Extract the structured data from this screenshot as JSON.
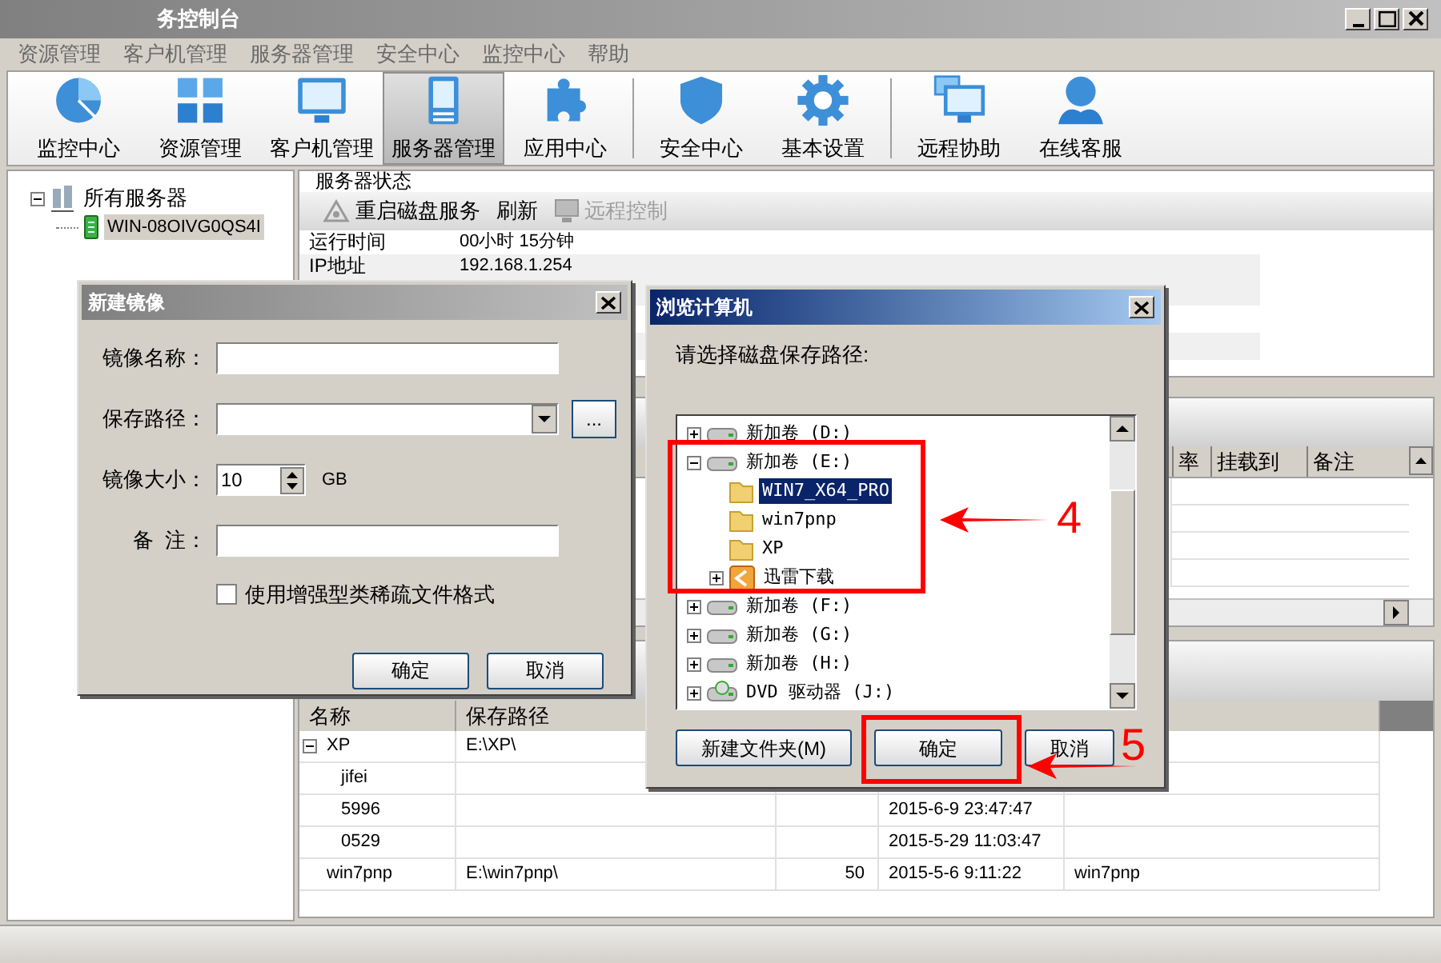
{
  "window": {
    "title": "务控制台"
  },
  "menu": [
    "资源管理",
    "客户机管理",
    "服务器管理",
    "安全中心",
    "监控中心",
    "帮助"
  ],
  "toolbar_groups": [
    [
      {
        "label": "监控中心",
        "selected": false
      },
      {
        "label": "资源管理",
        "selected": false
      },
      {
        "label": "客户机管理",
        "selected": false
      },
      {
        "label": "服务器管理",
        "selected": true
      },
      {
        "label": "应用中心",
        "selected": false
      }
    ],
    [
      {
        "label": "安全中心",
        "selected": false
      },
      {
        "label": "基本设置",
        "selected": false
      }
    ],
    [
      {
        "label": "远程协助",
        "selected": false
      },
      {
        "label": "在线客服",
        "selected": false
      }
    ]
  ],
  "server_tree": {
    "label": "所有服务器",
    "expanded": true,
    "children": [
      {
        "label": "WIN-08OIVG0QS4I",
        "selected": true
      }
    ]
  },
  "status_panel": {
    "title": "服务器状态",
    "actions": [
      {
        "label": "重启磁盘服务",
        "disabled": false
      },
      {
        "label": "刷新",
        "disabled": false
      },
      {
        "label": "远程控制",
        "disabled": true
      }
    ],
    "rows": [
      {
        "name": "运行时间",
        "value": "00小时 15分钟"
      },
      {
        "name": "IP地址",
        "value": "192.168.1.254"
      }
    ]
  },
  "disk_table": {
    "columns": [
      "率",
      "挂载到",
      "备注"
    ]
  },
  "image_table": {
    "columns": [
      "名称",
      "保存路径"
    ],
    "rows": [
      {
        "name": "XP",
        "path": "E:\\XP\\",
        "expanded": true,
        "children": [
          {
            "name": "jifei"
          },
          {
            "name": "5996",
            "column_4": "2015-6-9 23:47:47"
          },
          {
            "name": "0529",
            "column_4": "2015-5-29 11:03:47"
          }
        ]
      },
      {
        "name": "win7pnp",
        "path": "E:\\win7pnp\\",
        "column_3": "50",
        "column_4": "2015-5-6 9:11:22",
        "column_5": "win7pnp"
      }
    ]
  },
  "new_image_dialog": {
    "title": "新建镜像",
    "active": false,
    "fields": [
      {
        "kind": "text",
        "label": "镜像名称："
      },
      {
        "kind": "combo",
        "label": "保存路径：",
        "button": "..."
      },
      {
        "kind": "spin",
        "label": "镜像大小：",
        "value": "10",
        "unit": "GB"
      },
      {
        "kind": "text",
        "label": "备  注："
      }
    ],
    "checkbox": {
      "label": "使用增强型类稀疏文件格式",
      "checked": false
    },
    "buttons": [
      "确定",
      "取消"
    ]
  },
  "browse_dialog": {
    "title": "浏览计算机",
    "active": true,
    "prompt": "请选择磁盘保存路径:",
    "tree": [
      {
        "kind": "drive",
        "label": "新加卷 (D:)",
        "expanded": false
      },
      {
        "kind": "drive",
        "label": "新加卷 (E:)",
        "expanded": true,
        "children": [
          {
            "kind": "folder",
            "label": "WIN7_X64_PRO",
            "selected": true
          },
          {
            "kind": "folder",
            "label": "win7pnp",
            "selected": false
          },
          {
            "kind": "folder",
            "label": "XP",
            "selected": false
          },
          {
            "kind": "app-folder",
            "label": "迅雷下载",
            "expanded": false,
            "selected": false
          }
        ]
      },
      {
        "kind": "drive",
        "label": "新加卷 (F:)",
        "expanded": false
      },
      {
        "kind": "drive",
        "label": "新加卷 (G:)",
        "expanded": false
      },
      {
        "kind": "drive",
        "label": "新加卷 (H:)",
        "expanded": false
      },
      {
        "kind": "dvd",
        "label": "DVD 驱动器 (J:)",
        "expanded": false
      }
    ],
    "buttons": [
      "新建文件夹(M)",
      "确定",
      "取消"
    ]
  },
  "annotations": [
    {
      "label": "4"
    },
    {
      "label": "5"
    }
  ]
}
